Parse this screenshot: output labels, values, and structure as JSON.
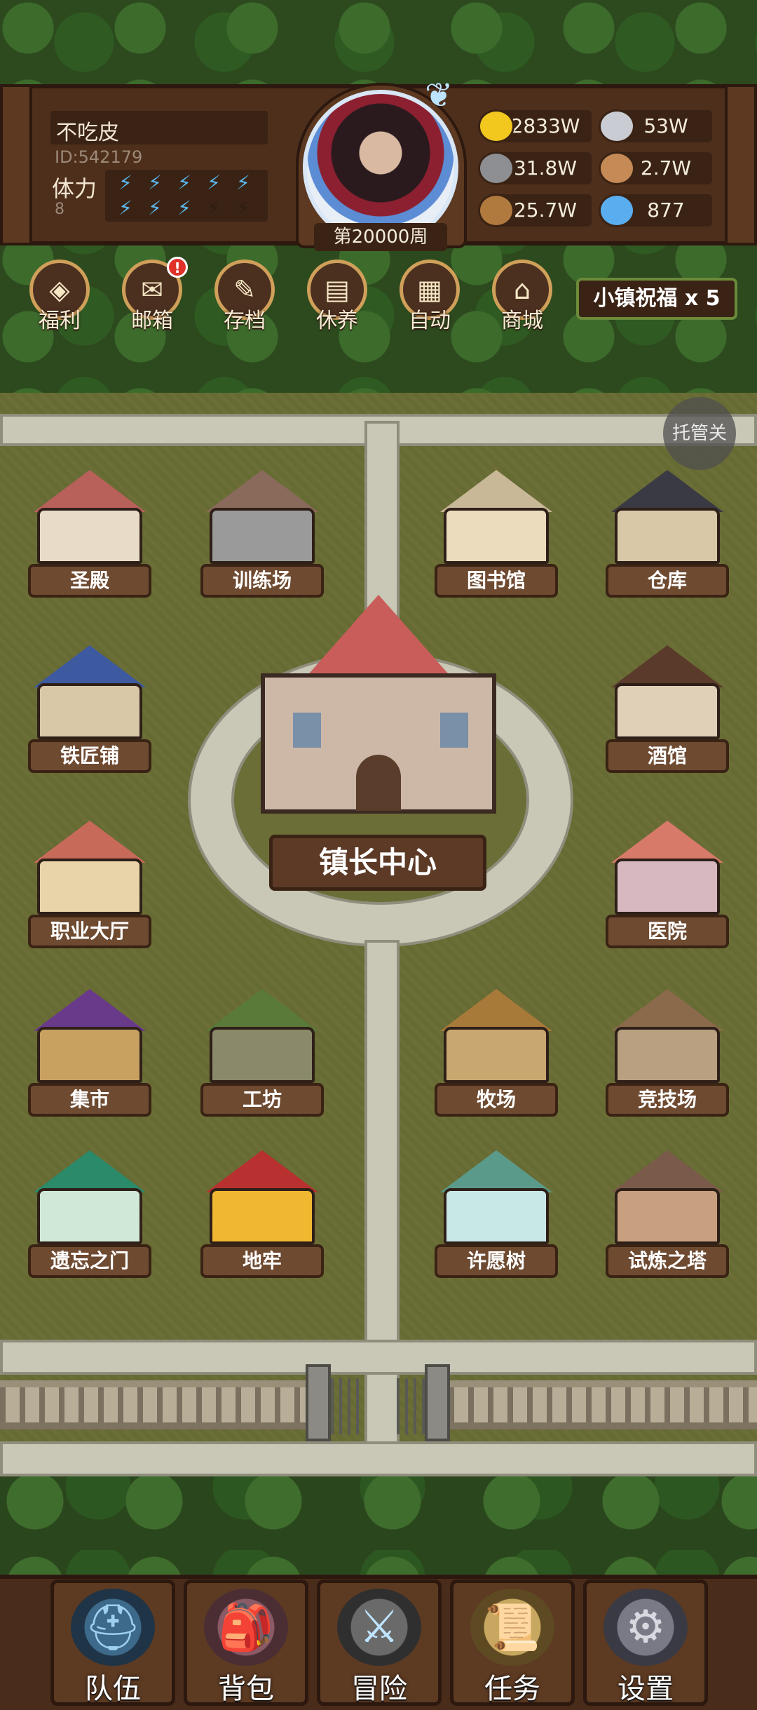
{
  "player": {
    "name": "不吃皮",
    "id": "ID:542179",
    "stamina_label": "体力",
    "stamina_value": "8",
    "stamina_bolts": [
      true,
      true,
      true,
      true,
      true,
      true,
      true,
      true,
      false,
      false
    ],
    "week": "第20000周"
  },
  "resources": [
    {
      "icon": "gold-coin-icon",
      "color": "#f2c81e",
      "value": "2833W"
    },
    {
      "icon": "iron-ingot-icon",
      "color": "#c9ccd2",
      "value": "53W"
    },
    {
      "icon": "stone-icon",
      "color": "#8d8f93",
      "value": "31.8W"
    },
    {
      "icon": "leather-icon",
      "color": "#c58a55",
      "value": "2.7W"
    },
    {
      "icon": "wood-log-icon",
      "color": "#b07a3e",
      "value": "25.7W"
    },
    {
      "icon": "crystal-icon",
      "color": "#5aaef0",
      "value": "877"
    }
  ],
  "menu": [
    {
      "name": "welfare",
      "label": "福利",
      "icon": "shield-icon",
      "badge": false
    },
    {
      "name": "mailbox",
      "label": "邮箱",
      "icon": "envelope-icon",
      "badge": true
    },
    {
      "name": "save",
      "label": "存档",
      "icon": "scroll-quill-icon",
      "badge": false
    },
    {
      "name": "rest",
      "label": "休养",
      "icon": "chest-icon",
      "badge": false
    },
    {
      "name": "auto",
      "label": "自动",
      "icon": "map-icon",
      "badge": false
    },
    {
      "name": "shop",
      "label": "商城",
      "icon": "shop-icon",
      "badge": false
    }
  ],
  "town_blessing": "小镇祝福 x 5",
  "managed_toggle": "托管关",
  "buildings": {
    "temple": "圣殿",
    "training_ground": "训练场",
    "library": "图书馆",
    "warehouse": "仓库",
    "blacksmith": "铁匠铺",
    "tavern": "酒馆",
    "mayor_center": "镇长中心",
    "career_hall": "职业大厅",
    "hospital": "医院",
    "market": "集市",
    "workshop": "工坊",
    "ranch": "牧场",
    "arena": "竞技场",
    "forgotten_gate": "遗忘之门",
    "dungeon": "地牢",
    "wishing_tree": "许愿树",
    "trial_tower": "试炼之塔"
  },
  "nav": {
    "team": "队伍",
    "bag": "背包",
    "adventure": "冒险",
    "quest": "任务",
    "settings": "设置"
  },
  "colors": {
    "badge_red": "#e0302a",
    "plaque": "#6e4a31",
    "wood_dark": "#4e2f1c"
  }
}
